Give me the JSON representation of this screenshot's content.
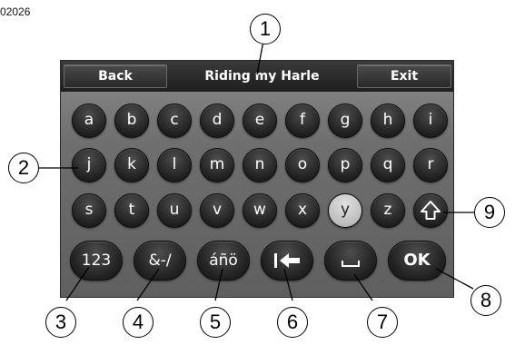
{
  "figure_id": "02026",
  "header": {
    "back_label": "Back",
    "title_text": "Riding my Harle",
    "exit_label": "Exit"
  },
  "keyboard": {
    "row1": [
      "a",
      "b",
      "c",
      "d",
      "e",
      "f",
      "g",
      "h",
      "i"
    ],
    "row2": [
      "j",
      "k",
      "l",
      "m",
      "n",
      "o",
      "p",
      "q",
      "r"
    ],
    "row3": [
      "s",
      "t",
      "u",
      "v",
      "w",
      "x",
      "y",
      "z"
    ],
    "highlighted_key": "y",
    "bottom": {
      "numbers_label": "123",
      "symbols_label": "&-/",
      "accents_label": "áñö",
      "ok_label": "OK"
    },
    "icons": {
      "shift": "shift-up-arrow-icon",
      "backspace": "backspace-arrow-icon",
      "space": "space-bar-icon"
    }
  },
  "callouts": [
    "1",
    "2",
    "3",
    "4",
    "5",
    "6",
    "7",
    "8",
    "9"
  ],
  "colors": {
    "screen_bg": "#6f6f6f",
    "key_bg": "#232323",
    "key_text": "#ffffff",
    "highlight": "#c8c8c8"
  }
}
